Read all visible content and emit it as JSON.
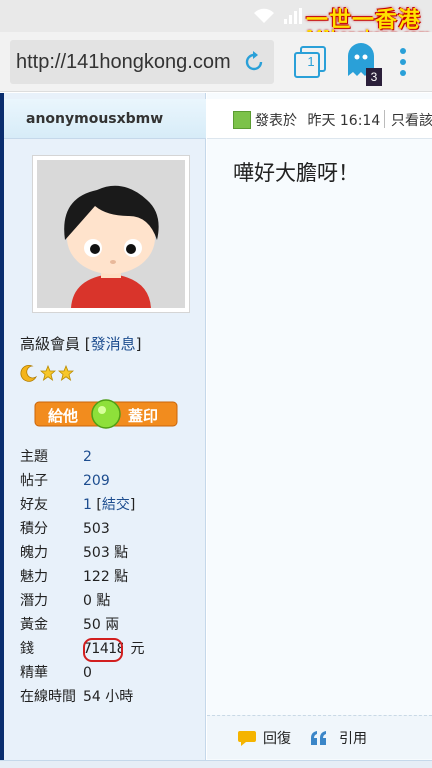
{
  "status_bar": {
    "wifi_icon": "wifi-icon",
    "signal_icon": "signal-icon",
    "brand_text": "一世一香港",
    "brand_url": "141hongkong.com"
  },
  "browser": {
    "url": "http://141hongkong.com",
    "tab_count": "1",
    "notification_count": "3"
  },
  "sidebar": {
    "username": "anonymousxbmw",
    "rank_label": "高級會員",
    "send_message_link": "發消息",
    "stamp_button": {
      "left": "給他",
      "right": "蓋印"
    },
    "stats": [
      {
        "key": "主題",
        "value": "2",
        "link": true
      },
      {
        "key": "帖子",
        "value": "209",
        "link": true
      },
      {
        "key": "好友",
        "value": "1",
        "link": true,
        "extra": "結交"
      },
      {
        "key": "積分",
        "value": "503"
      },
      {
        "key": "魄力",
        "value": "503 點"
      },
      {
        "key": "魅力",
        "value": "122 點"
      },
      {
        "key": "潛力",
        "value": "0 點"
      },
      {
        "key": "黃金",
        "value": "50 兩"
      },
      {
        "key": "錢",
        "value": "71418",
        "unit": "元",
        "highlighted": true
      },
      {
        "key": "精華",
        "value": "0"
      },
      {
        "key": "在線時間",
        "value": "54 小時"
      }
    ]
  },
  "post": {
    "posted_label": "發表於",
    "posted_time": "昨天 16:14",
    "view_all_label": "只看該",
    "body": "嘩好大膽呀！",
    "reply_label": "回復",
    "quote_label": "引用"
  },
  "colors": {
    "link": "#1d4d8f",
    "sidebar_bg": "#e8f1fa",
    "highlight_ring": "#d21f1f",
    "brand_yellow": "#ffe200"
  }
}
